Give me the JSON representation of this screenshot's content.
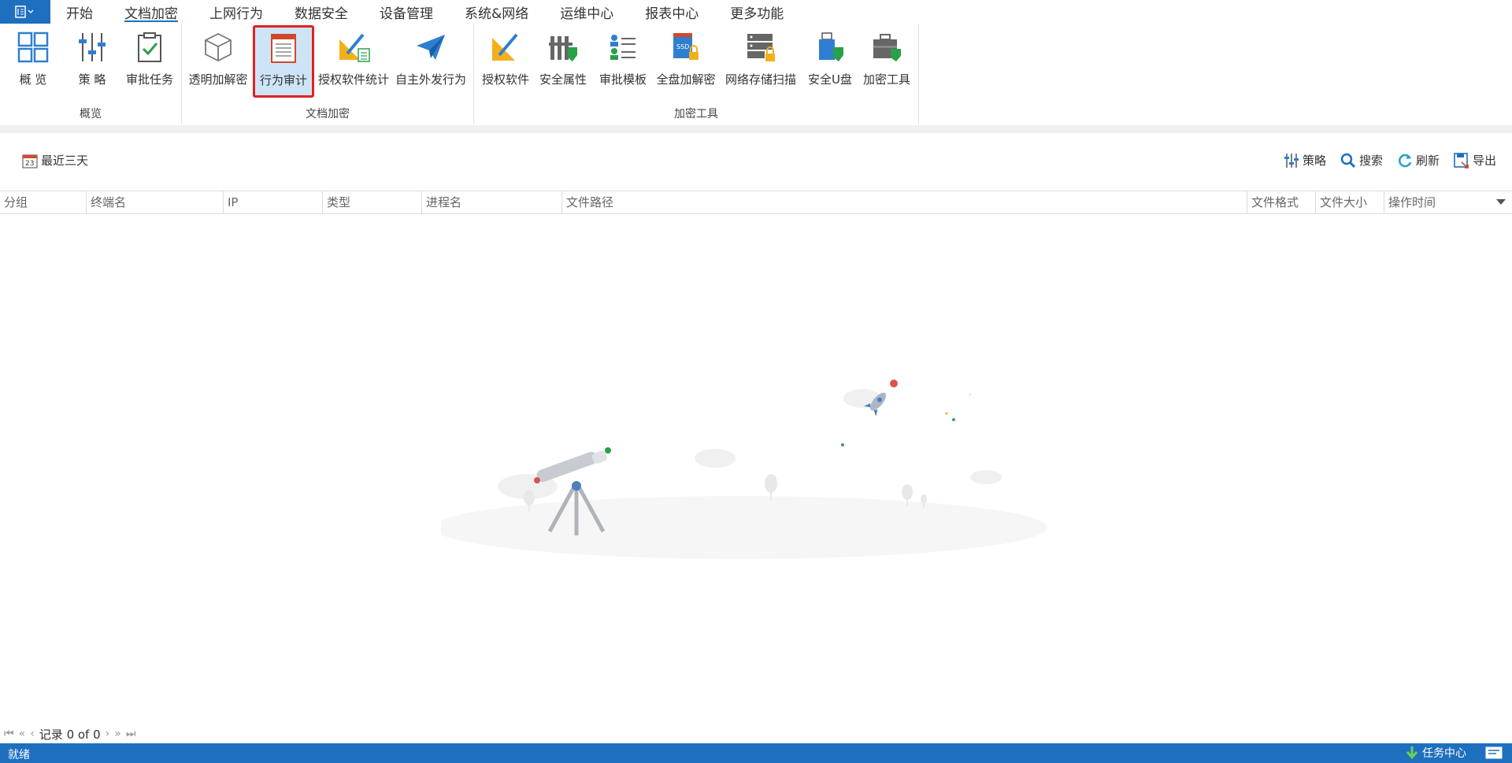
{
  "menu": {
    "tabs": [
      "开始",
      "文档加密",
      "上网行为",
      "数据安全",
      "设备管理",
      "系统&网络",
      "运维中心",
      "报表中心",
      "更多功能"
    ],
    "active_tab": "文档加密"
  },
  "ribbon": {
    "groups": [
      {
        "label": "概览",
        "buttons": [
          "概 览",
          "策 略",
          "审批任务"
        ]
      },
      {
        "label": "文档加密",
        "buttons": [
          "透明加解密",
          "行为审计",
          "授权软件统计",
          "自主外发行为"
        ]
      },
      {
        "label": "加密工具",
        "buttons": [
          "授权软件",
          "安全属性",
          "审批模板",
          "全盘加解密",
          "网络存储扫描",
          "安全U盘",
          "加密工具"
        ]
      }
    ],
    "selected_button": "行为审计",
    "calendar_day": "23"
  },
  "toolbar": {
    "date_range": "最近三天",
    "policy": "策略",
    "search": "搜索",
    "refresh": "刷新",
    "export": "导出"
  },
  "grid": {
    "columns": [
      "分组",
      "终端名",
      "IP",
      "类型",
      "进程名",
      "文件路径",
      "文件格式",
      "文件大小",
      "操作时间"
    ],
    "rows": []
  },
  "pager": {
    "record_text": "记录 0 of 0"
  },
  "status": {
    "left": "就绪",
    "task_center": "任务中心"
  },
  "colors": {
    "accent": "#1f6fbf",
    "selected_bg": "#cde4f7",
    "highlight_border": "#e02020"
  }
}
